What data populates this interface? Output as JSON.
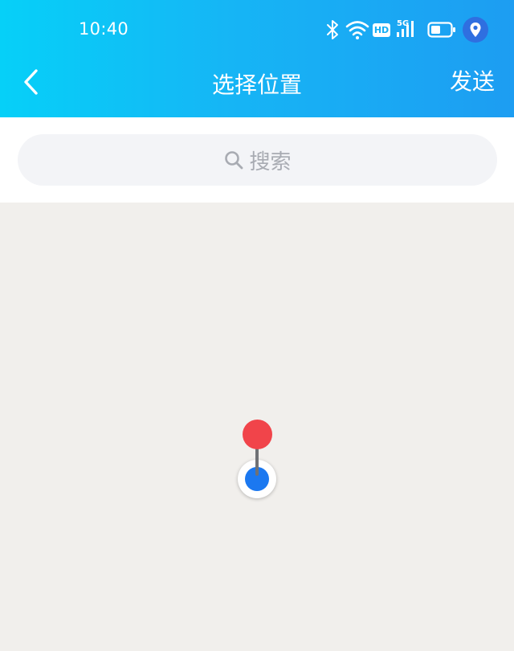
{
  "status_bar": {
    "time": "10:40",
    "icons": [
      "bluetooth-icon",
      "wifi-icon",
      "hd-icon",
      "5g-signal-icon",
      "battery-icon",
      "location-icon"
    ],
    "hd_label": "HD",
    "network_label": "5G"
  },
  "nav": {
    "title": "选择位置",
    "send_label": "发送",
    "back_icon": "chevron-left-icon"
  },
  "search": {
    "placeholder": "搜索",
    "icon": "search-icon"
  },
  "colors": {
    "header_gradient_start": "#06d0f8",
    "header_gradient_end": "#1d9df2",
    "map_background": "#f1efec",
    "pin_red": "#f1444a",
    "location_blue": "#1b78f0"
  }
}
